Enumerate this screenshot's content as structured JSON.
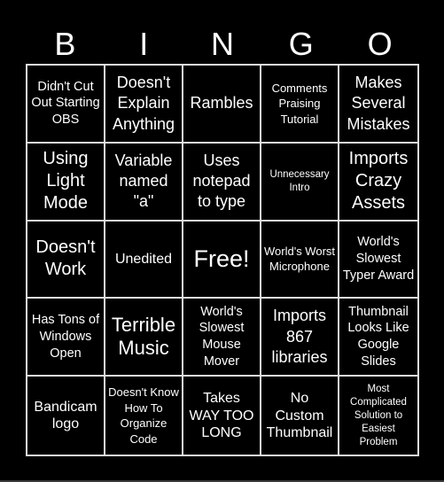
{
  "title_letters": [
    "B",
    "I",
    "N",
    "G",
    "O"
  ],
  "colors": {
    "background": "#000000",
    "text": "#ffffff",
    "grid_line": "#e0e0e0"
  },
  "cells": [
    [
      "Didn't Cut Out Starting OBS",
      "Doesn't Explain Anything",
      "Rambles",
      "Comments Praising Tutorial",
      "Makes Several Mistakes"
    ],
    [
      "Using Light Mode",
      "Variable named \"a\"",
      "Uses notepad to type",
      "Unnecessary Intro",
      "Imports Crazy Assets"
    ],
    [
      "Doesn't Work",
      "Unedited",
      "Free!",
      "World's Worst Microphone",
      "World's Slowest Typer Award"
    ],
    [
      "Has Tons of Windows Open",
      "Terrible Music",
      "World's Slowest Mouse Mover",
      "Imports 867 libraries",
      "Thumbnail Looks Like Google Slides"
    ],
    [
      "Bandicam logo",
      "Doesn't Know How To Organize Code",
      "Takes WAY TOO LONG",
      "No Custom Thumbnail",
      "Most Complicated Solution to Easiest Problem"
    ]
  ]
}
